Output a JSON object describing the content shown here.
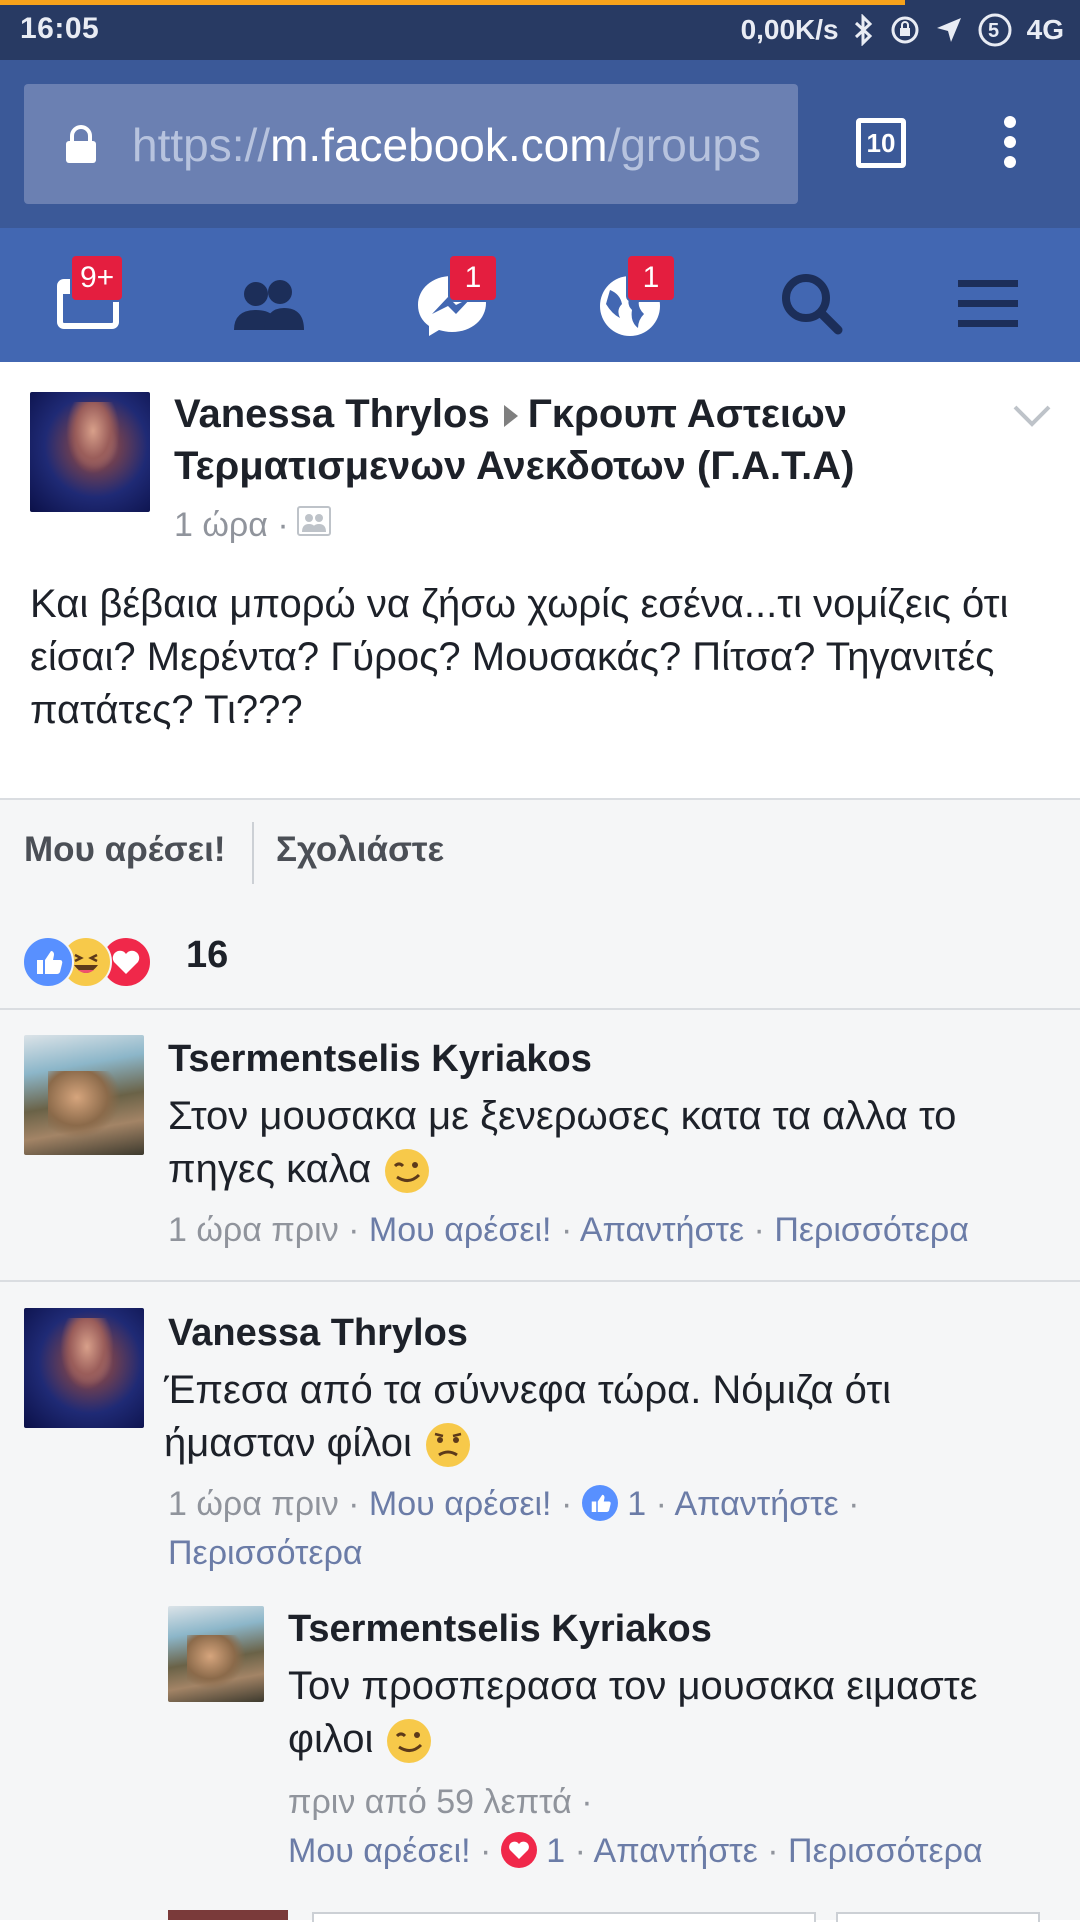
{
  "status_bar": {
    "time": "16:05",
    "net_speed": "0,00K/s",
    "network": "4G",
    "icons": [
      "bluetooth-icon",
      "rotation-lock-icon",
      "location-icon",
      "signal-icon"
    ]
  },
  "browser": {
    "url_scheme": "https://",
    "url_host": "m.facebook.com",
    "url_path": "/groups",
    "tab_count": "10",
    "icons": [
      "lock-icon",
      "tabs-icon",
      "overflow-menu-icon"
    ]
  },
  "fb_nav": {
    "items": [
      {
        "name": "news-feed",
        "badge": "9+"
      },
      {
        "name": "friend-requests",
        "badge": ""
      },
      {
        "name": "messages",
        "badge": "1"
      },
      {
        "name": "notifications",
        "badge": "1"
      },
      {
        "name": "search",
        "badge": ""
      },
      {
        "name": "menu",
        "badge": ""
      }
    ],
    "colors": {
      "bar": "#4267b2",
      "badge": "#e41e3f"
    }
  },
  "post": {
    "author": "Vanessa Thrylos",
    "group": "Γκρουπ Αστειων Τερματισμενων Ανεκδοτων (Γ.Α.Τ.Α)",
    "time": "1 ώρα ·",
    "text": "Και βέβαια μπορώ να ζήσω χωρίς εσένα...τι νομίζεις ότι είσαι? Μερέντα? Γύρος? Μουσακάς? Πίτσα? Τηγανιτές πατάτες? Τι???",
    "like_action": "Μου αρέσει!",
    "comment_action": "Σχολιάστε",
    "reaction_count": "16",
    "reactions": [
      "like",
      "haha",
      "love"
    ]
  },
  "comments": [
    {
      "author": "Tsermentselis Kyriakos",
      "text": "Στον μουσακα με ξενερωσες κατα τα αλλα το πηγες καλα",
      "emoji": "wink",
      "time": "1 ώρα πριν ·",
      "like": "Μου αρέσει!",
      "reply": "Απαντήστε",
      "more": "Περισσότερα"
    },
    {
      "author": "Vanessa Thrylos",
      "text": "Έπεσα από τα σύννεφα τώρα. Νόμιζα ότι ήμασταν φίλοι",
      "emoji": "confused",
      "time": "1 ώρα πριν ·",
      "like": "Μου αρέσει!",
      "like_count": "1",
      "reply": "Απαντήστε",
      "more": "Περισσότερα"
    },
    {
      "author": "Tsermentselis Kyriakos",
      "text": "Τον προσπερασα τον μουσακα ειμαστε φιλοι",
      "emoji": "wink",
      "time": "πριν από 59 λεπτά ·",
      "like": "Μου αρέσει!",
      "love_count": "1",
      "reply": "Απαντήστε",
      "more": "Περισσότερα",
      "is_reply": true
    }
  ]
}
